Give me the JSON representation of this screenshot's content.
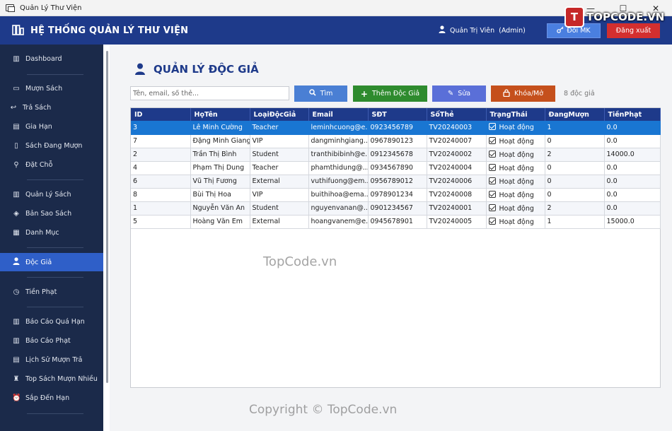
{
  "window": {
    "title": "Quản Lý Thư Viện",
    "minimize": "—",
    "maximize": "☐",
    "close": "✕"
  },
  "brand": {
    "mark": "T",
    "text": "TOPCODE.VN"
  },
  "header": {
    "app_title": "HỆ THỐNG QUẢN LÝ THƯ VIỆN",
    "user_name": "Quản Trị Viên",
    "user_role": "(Admin)",
    "change_password_label": "Đổi MK",
    "logout_label": "Đăng xuất"
  },
  "sidebar": {
    "items": [
      {
        "label": "Dashboard",
        "icon": "chart-icon"
      },
      {
        "label": "Mượn Sách",
        "icon": "book-icon"
      },
      {
        "label": "Trả Sách",
        "icon": "return-icon"
      },
      {
        "label": "Gia Hạn",
        "icon": "calendar-icon"
      },
      {
        "label": "Sách Đang Mượn",
        "icon": "book-open-icon"
      },
      {
        "label": "Đặt Chỗ",
        "icon": "pin-icon"
      },
      {
        "label": "Quản Lý Sách",
        "icon": "books-icon"
      },
      {
        "label": "Bản Sao Sách",
        "icon": "box-icon"
      },
      {
        "label": "Danh Mục",
        "icon": "folder-icon"
      },
      {
        "label": "Độc Giả",
        "icon": "user-icon"
      },
      {
        "label": "Tiền Phạt",
        "icon": "money-icon"
      },
      {
        "label": "Báo Cáo Quá Hạn",
        "icon": "report-icon"
      },
      {
        "label": "Báo Cáo Phạt",
        "icon": "report-icon"
      },
      {
        "label": "Lịch Sử Mượn Trả",
        "icon": "history-icon"
      },
      {
        "label": "Top Sách Mượn Nhiều",
        "icon": "trophy-icon"
      },
      {
        "label": "Sắp Đến Hạn",
        "icon": "clock-icon"
      }
    ],
    "active": "Độc Giả"
  },
  "main": {
    "page_title": "QUẢN LÝ ĐỘC GIẢ",
    "search_placeholder": "Tên, email, số thẻ...",
    "search_button": "Tìm",
    "add_button": "Thêm Độc Giả",
    "edit_button": "Sửa",
    "lock_button": "Khóa/Mở",
    "count_label": "8 độc giả"
  },
  "table": {
    "columns": [
      "ID",
      "HọTên",
      "LoạiĐộcGiả",
      "Email",
      "SĐT",
      "SốThẻ",
      "TrạngThái",
      "ĐangMượn",
      "TiềnPhạt"
    ],
    "rows": [
      [
        "3",
        "Lê Minh Cường",
        "Teacher",
        "leminhcuong@e...",
        "0923456789",
        "TV20240003",
        "Hoạt động",
        "1",
        "0.0"
      ],
      [
        "7",
        "Đặng Minh Giang",
        "VIP",
        "dangminhgiang...",
        "0967890123",
        "TV20240007",
        "Hoạt động",
        "0",
        "0.0"
      ],
      [
        "2",
        "Trần Thị Bình",
        "Student",
        "tranthibibinh@e...",
        "0912345678",
        "TV20240002",
        "Hoạt động",
        "2",
        "14000.0"
      ],
      [
        "4",
        "Phạm Thị Dung",
        "Teacher",
        "phamthidung@...",
        "0934567890",
        "TV20240004",
        "Hoạt động",
        "0",
        "0.0"
      ],
      [
        "6",
        "Vũ Thị Fương",
        "External",
        "vuthifuong@em...",
        "0956789012",
        "TV20240006",
        "Hoạt động",
        "0",
        "0.0"
      ],
      [
        "8",
        "Bùi Thị Hoa",
        "VIP",
        "buithihoa@ema...",
        "0978901234",
        "TV20240008",
        "Hoạt động",
        "0",
        "0.0"
      ],
      [
        "1",
        "Nguyễn Văn An",
        "Student",
        "nguyenvanan@...",
        "0901234567",
        "TV20240001",
        "Hoạt động",
        "2",
        "0.0"
      ],
      [
        "5",
        "Hoàng Văn Em",
        "External",
        "hoangvanem@e...",
        "0945678901",
        "TV20240005",
        "Hoạt động",
        "1",
        "15000.0"
      ]
    ],
    "selected_row": 0
  },
  "watermarks": {
    "center": "TopCode.vn",
    "bottom": "Copyright © TopCode.vn"
  }
}
